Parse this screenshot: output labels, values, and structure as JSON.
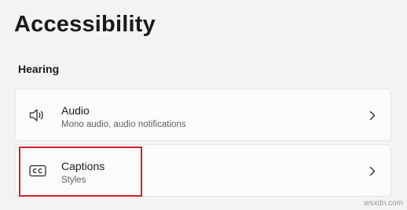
{
  "page": {
    "title": "Accessibility"
  },
  "section": {
    "header": "Hearing"
  },
  "items": [
    {
      "title": "Audio",
      "subtitle": "Mono audio, audio notifications",
      "icon": "speaker-icon"
    },
    {
      "title": "Captions",
      "subtitle": "Styles",
      "icon": "closed-captions-icon"
    }
  ],
  "annotation": {
    "highlight_color": "#d21f2b"
  },
  "watermark": {
    "text": "wsxdn.com"
  },
  "colors": {
    "background": "#f3f3f3",
    "card": "#fbfbfb",
    "card_border": "#e5e5e5"
  }
}
